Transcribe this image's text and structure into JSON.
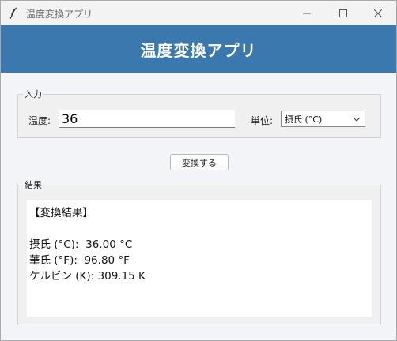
{
  "window": {
    "title": "温度変換アプリ"
  },
  "header": {
    "title": "温度変換アプリ"
  },
  "input_section": {
    "label": "入力",
    "temperature_label": "温度:",
    "temperature_value": "36",
    "unit_label": "単位:",
    "unit_selected": "摂氏 (°C)"
  },
  "convert_button": {
    "label": "変換する"
  },
  "result_section": {
    "label": "結果",
    "lines": [
      "【変換結果】",
      "",
      "摂氏 (°C):  36.00 °C",
      "華氏 (°F):  96.80 °F",
      "ケルビン (K): 309.15 K"
    ]
  },
  "colors": {
    "header_bg": "#3b78ae",
    "header_text": "#ffffff",
    "window_bg": "#f3f4f8"
  },
  "icons": [
    "feather-app-icon",
    "minimize-icon",
    "maximize-icon",
    "close-icon",
    "chevron-down-icon"
  ]
}
